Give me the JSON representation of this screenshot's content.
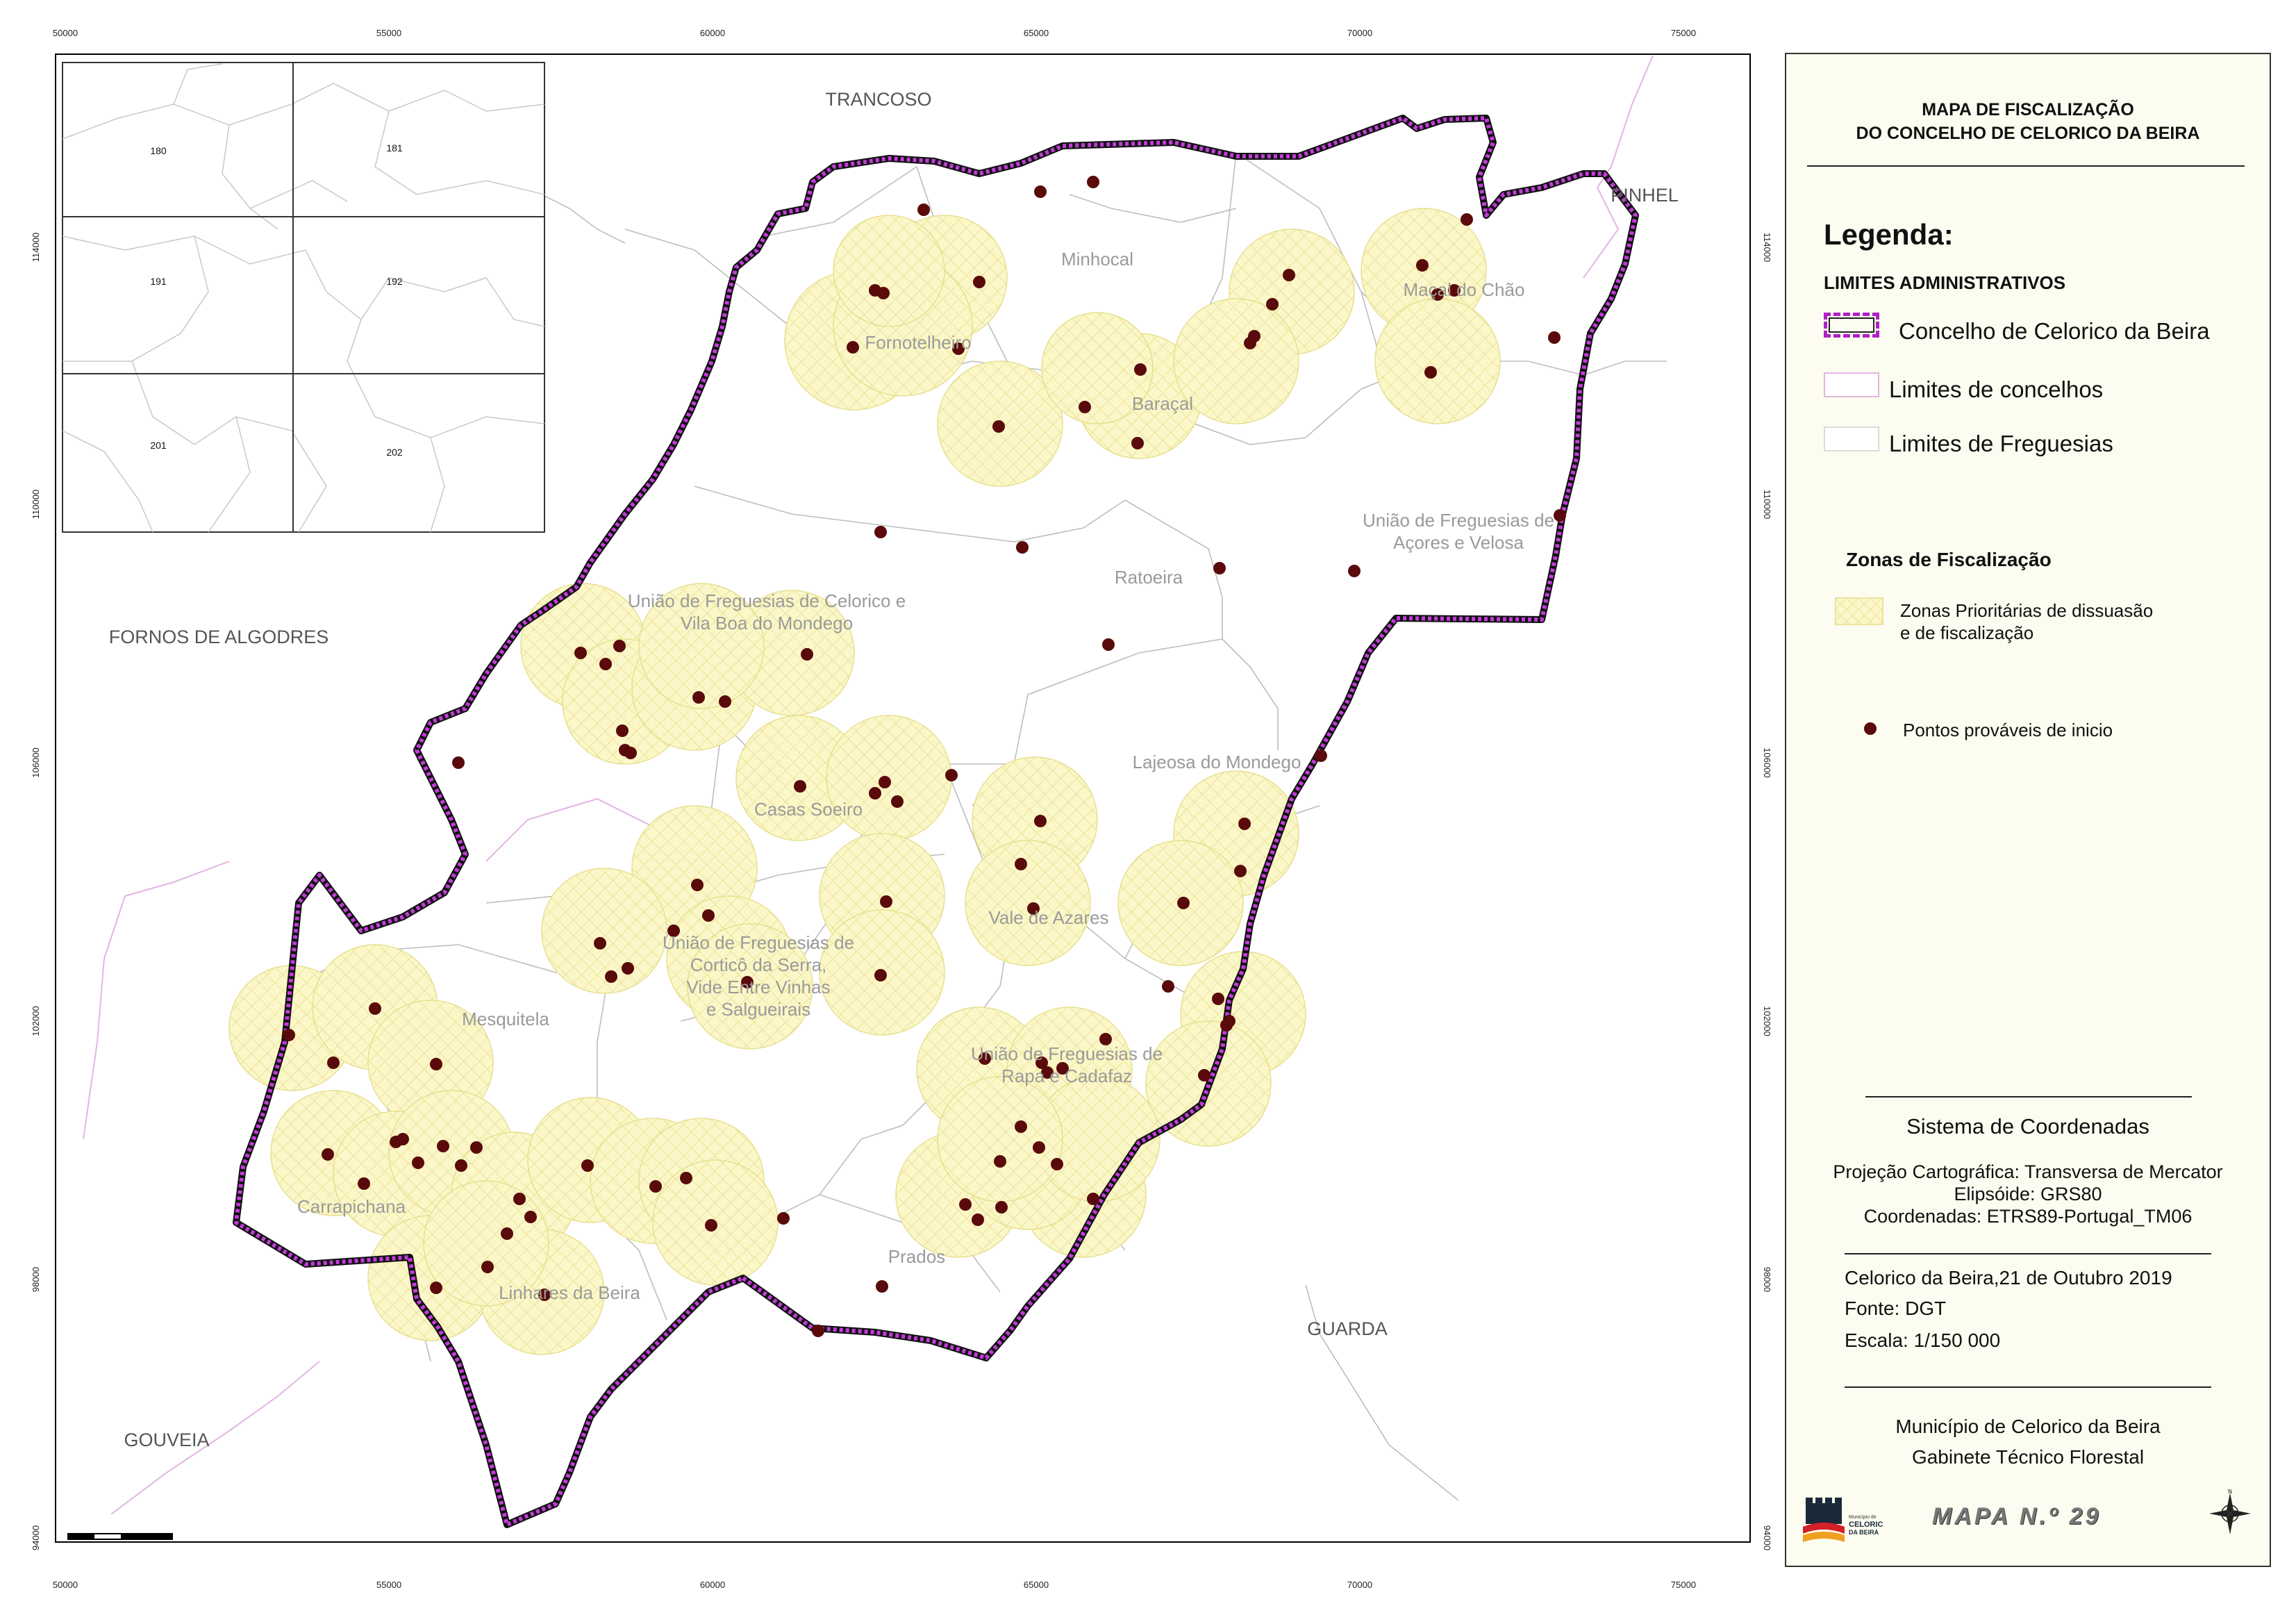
{
  "map": {
    "x_ticks": [
      "50000",
      "55000",
      "60000",
      "65000",
      "70000",
      "75000"
    ],
    "y_ticks": [
      "114000",
      "110000",
      "106000",
      "102000",
      "98000",
      "94000"
    ],
    "neighbors": {
      "trancoso": "TRANCOSO",
      "pinhel": "PINHEL",
      "fornos": "FORNOS DE ALGODRES",
      "gouveia": "GOUVEIA",
      "guarda": "GUARDA"
    },
    "parishes": {
      "minhocal": "Minhocal",
      "fornotelheiro": "Fornotelheiro",
      "baracal": "Baraçal",
      "macal": "Maçal do Chão",
      "acores1": "União de Freguesias de",
      "acores2": "Açores e Velosa",
      "ratoeira": "Ratoeira",
      "celorico1": "União de Freguesias de Celorico e",
      "celorico2": "Vila Boa do Mondego",
      "lajeosa": "Lajeosa do Mondego",
      "casas": "Casas Soeiro",
      "cortico1": "União de Freguesias de",
      "cortico2": "Corticô da Serra,",
      "cortico3": "Vide Entre Vinhas",
      "cortico4": "e Salgueirais",
      "vale": "Vale de Azares",
      "mesquitela": "Mesquitela",
      "rapa1": "União de Freguesias de",
      "rapa2": "Rapa e Cadafaz",
      "carrapichana": "Carrapichana",
      "linhares": "Linhares da Beira",
      "prados": "Prados"
    },
    "inset_sheets": [
      "180",
      "181",
      "191",
      "192",
      "201",
      "202"
    ]
  },
  "legend": {
    "title1": "MAPA DE FISCALIZAÇÃO",
    "title2": "DO CONCELHO DE CELORICO DA BEIRA",
    "heading": "Legenda:",
    "admin_heading": "LIMITES ADMINISTRATIVOS",
    "concelho": "Concelho de Celorico da Beira",
    "limites_concelhos": "Limites de concelhos",
    "limites_freguesias": "Limites de Freguesias",
    "zonas_heading": "Zonas de Fiscalização",
    "zonas1": "Zonas Prioritárias de dissuasão",
    "zonas2": "e de fiscalização",
    "pontos": "Pontos prováveis de inicio",
    "coord_title": "Sistema de Coordenadas",
    "proj": "Projeção Cartográfica: Transversa de Mercator",
    "elip": "Elipsóide: GRS80",
    "coords": "Coordenadas: ETRS89-Portugal_TM06",
    "date": "Celorico da Beira,21 de Outubro 2019",
    "source": "Fonte: DGT",
    "scale": "Escala: 1/150 000",
    "org1": "Município de Celorico da Beira",
    "org2": "Gabinete Técnico Florestal",
    "map_no": "MAPA N.º 29",
    "logo_text1": "Município de",
    "logo_text2": "CELORICO",
    "logo_text3": "DA BEIRA"
  },
  "colors": {
    "boundary": "#b020c8",
    "zone_fill": "#fbf7c4",
    "point": "#5a0a0a",
    "neighbor_line": "#e2b6e2"
  }
}
